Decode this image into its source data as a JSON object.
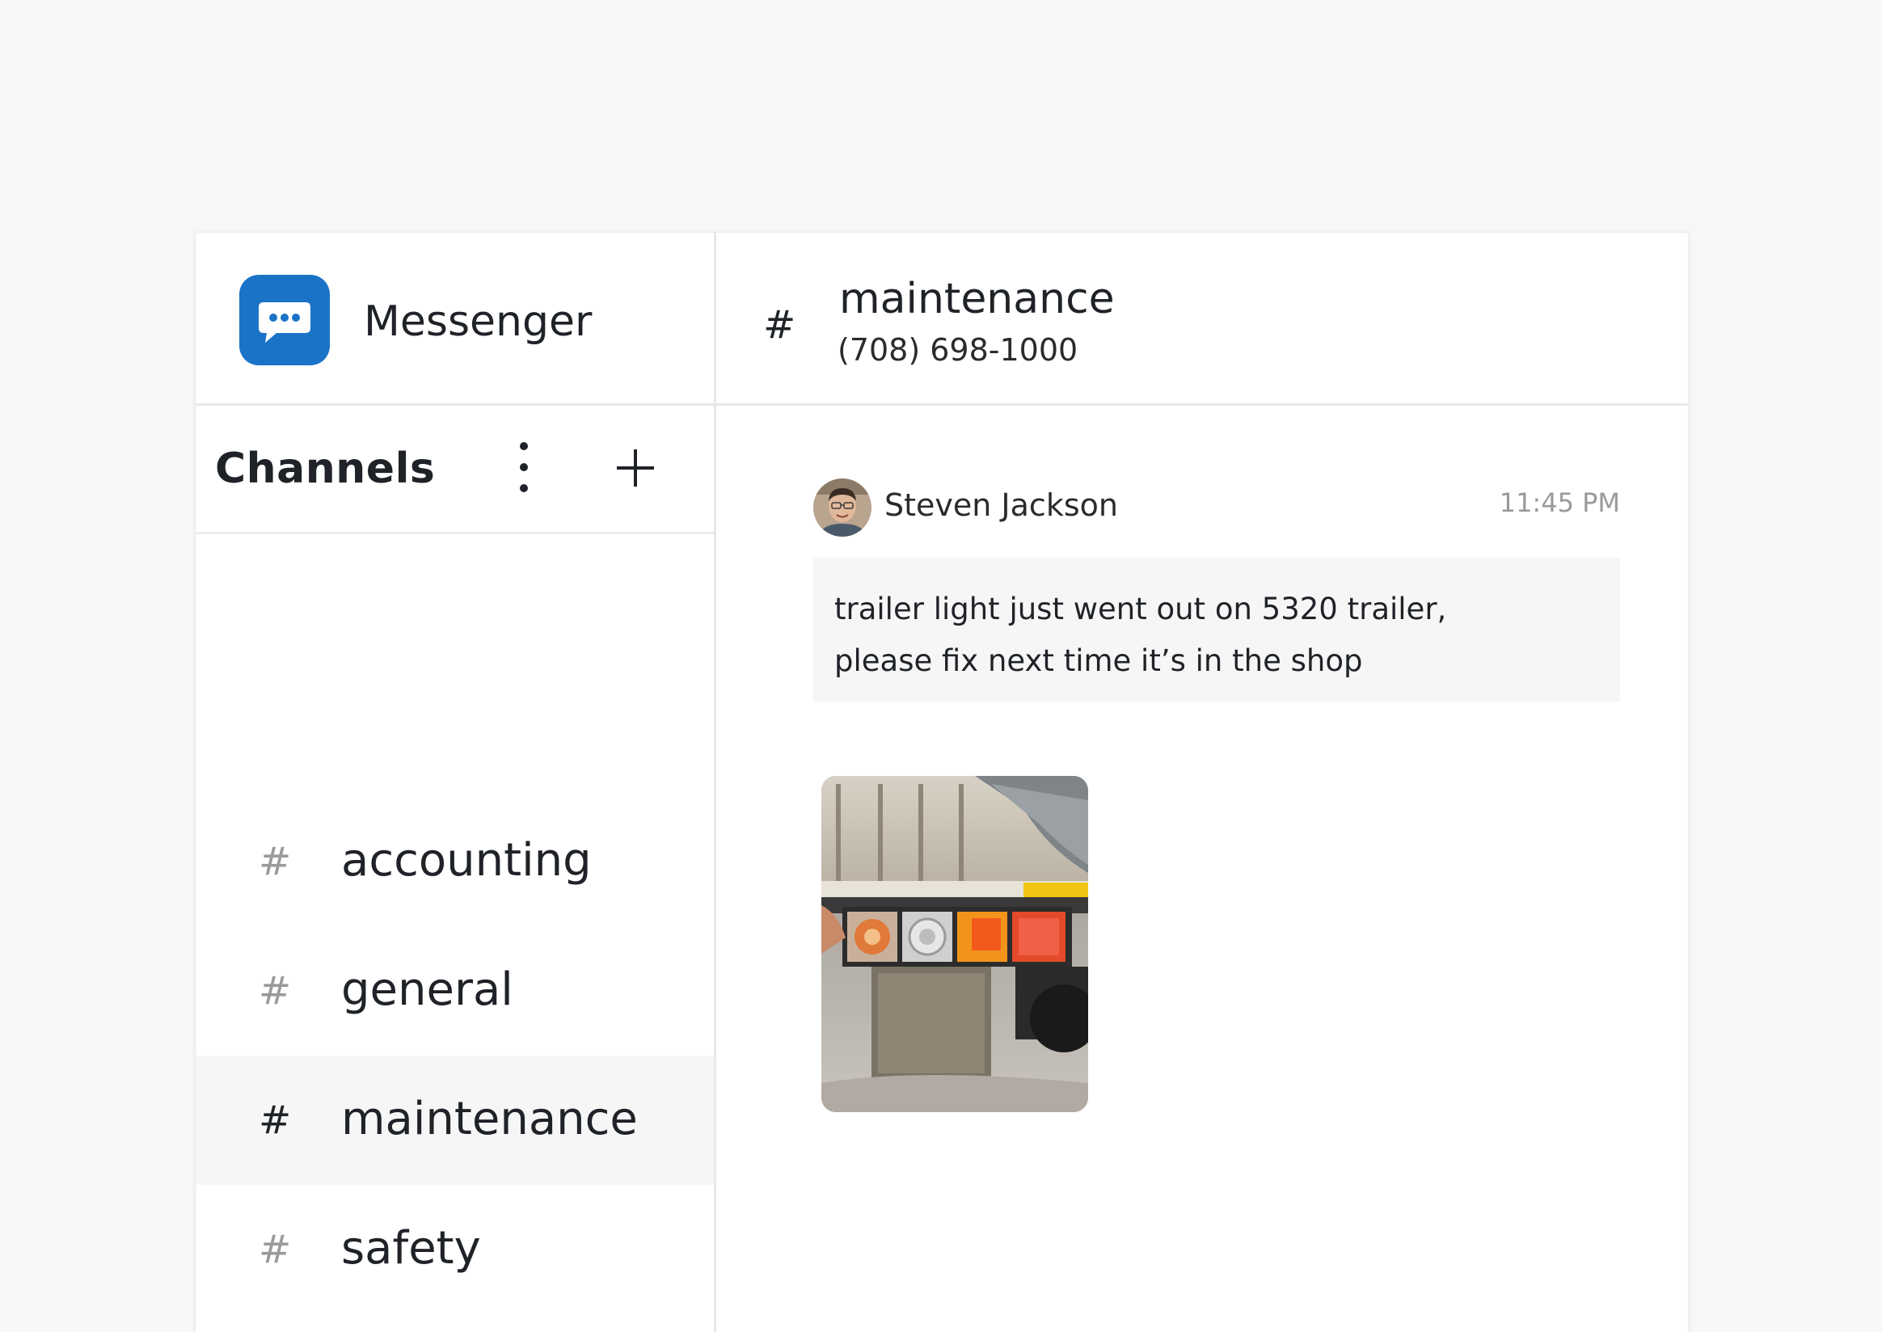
{
  "app": {
    "title": "Messenger",
    "logo_icon": "chat-bubble-icon",
    "accent_color": "#1b73c8"
  },
  "sidebar": {
    "header": "Channels",
    "more_icon": "vertical-ellipsis-icon",
    "add_icon": "plus-icon",
    "channels": [
      {
        "hash": "#",
        "label": "accounting",
        "active": false
      },
      {
        "hash": "#",
        "label": "general",
        "active": false
      },
      {
        "hash": "#",
        "label": "maintenance",
        "active": true
      },
      {
        "hash": "#",
        "label": "safety",
        "active": false
      }
    ]
  },
  "conversation": {
    "hash": "#",
    "channel_name": "maintenance",
    "phone": "(708) 698-1000"
  },
  "message": {
    "author": "Steven Jackson",
    "time": "11:45 PM",
    "text_line1": "trailer light just went out on 5320 trailer,",
    "text_line2": "please fix next time it’s in the shop",
    "attachment_icon": "photo-attachment"
  }
}
